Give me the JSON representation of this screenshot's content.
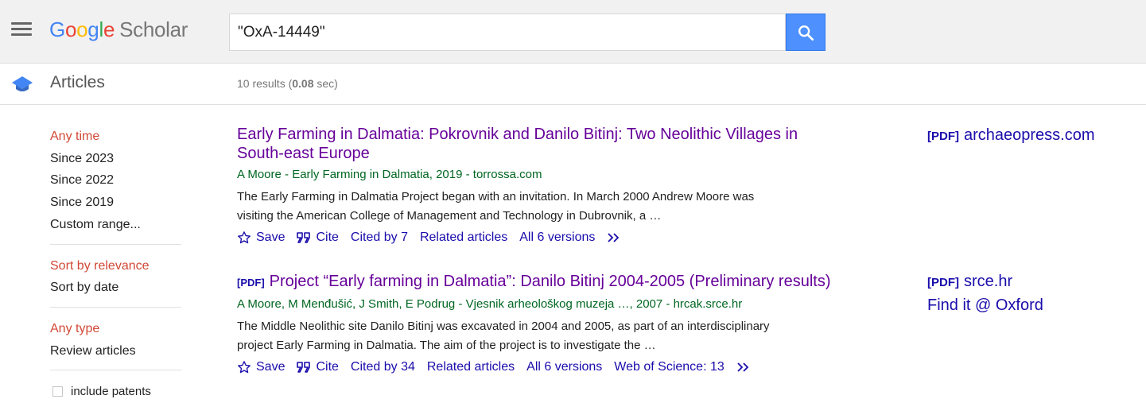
{
  "header": {
    "logo_google": "Google",
    "logo_scholar": "Scholar",
    "search_value": "\"OxA-14449\""
  },
  "subbar": {
    "section": "Articles",
    "results_prefix": "10 results (",
    "results_time": "0.08",
    "results_suffix": " sec)"
  },
  "sidebar": {
    "time": [
      "Any time",
      "Since 2023",
      "Since 2022",
      "Since 2019",
      "Custom range..."
    ],
    "sort": [
      "Sort by relevance",
      "Sort by date"
    ],
    "type": [
      "Any type",
      "Review articles"
    ],
    "patents_label": "include patents"
  },
  "results": [
    {
      "pdf_tag": "",
      "title": "Early Farming in Dalmatia: Pokrovnik and Danilo Bitinj: Two Neolithic Villages in South-east Europe",
      "authors": "A Moore - Early Farming in Dalmatia, 2019 - torrossa.com",
      "snippet": "The Early Farming in Dalmatia Project began with an invitation. In March 2000 Andrew Moore was visiting the American College of Management and Technology in Dubrovnik, a …",
      "save": "Save",
      "cite": "Cite",
      "cited_by": "Cited by 7",
      "related": "Related articles",
      "versions": "All 6 versions",
      "wos": "",
      "side_pdf": "[PDF]",
      "side_source": "archaeopress.com",
      "side_findit": ""
    },
    {
      "pdf_tag": "[PDF]",
      "title": "Project “Early farming in Dalmatia”: Danilo Bitinj 2004-2005 (Preliminary results)",
      "authors": "A Moore, M Menđušić, J Smith, E Podrug - Vjesnik arheološkog muzeja …, 2007 - hrcak.srce.hr",
      "snippet": "The Middle Neolithic site Danilo Bitinj was excavated in 2004 and 2005, as part of an interdisciplinary project Early Farming in Dalmatia. The aim of the project is to investigate the …",
      "save": "Save",
      "cite": "Cite",
      "cited_by": "Cited by 34",
      "related": "Related articles",
      "versions": "All 6 versions",
      "wos": "Web of Science: 13",
      "side_pdf": "[PDF]",
      "side_source": "srce.hr",
      "side_findit": "Find it @ Oxford"
    }
  ],
  "colors": {
    "g_blue": "#4285F4",
    "g_red": "#EA4335",
    "g_yellow": "#FBBC05",
    "g_green": "#34A853",
    "link": "#1a0dab",
    "visited": "#660099",
    "active_filter": "#d14836",
    "author_green": "#006621"
  },
  "icons": {
    "menu": "hamburger-menu-icon",
    "search": "search-icon",
    "section": "graduation-cap-icon",
    "save": "star-icon",
    "cite": "quote-icon",
    "more": "double-chevron-icon"
  }
}
